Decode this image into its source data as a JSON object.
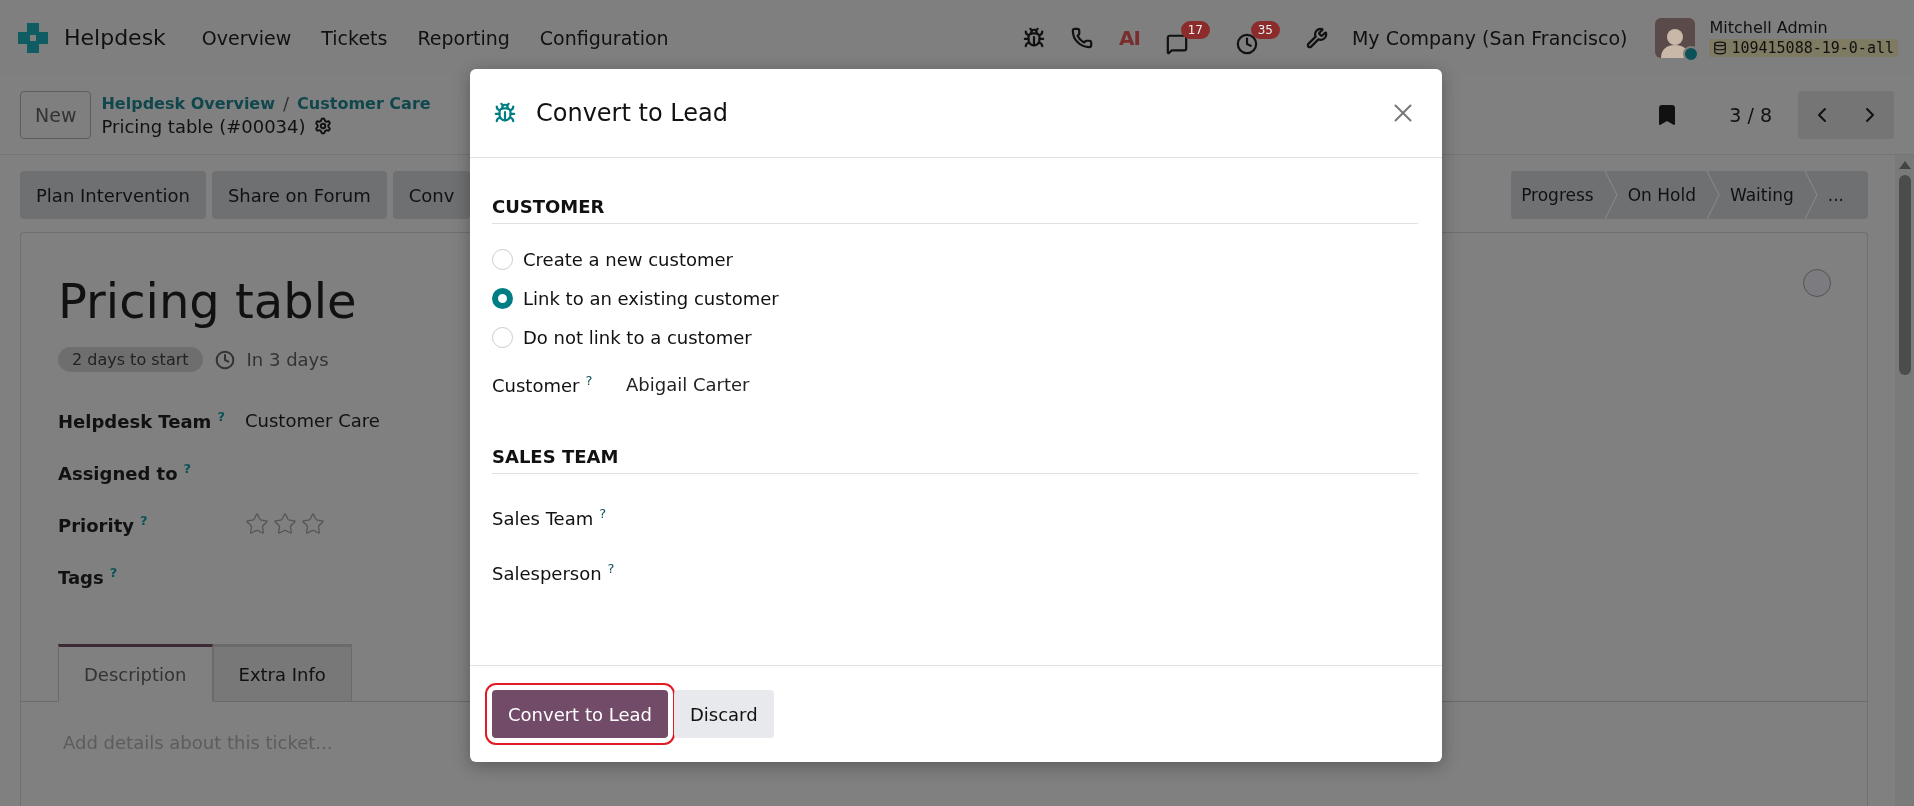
{
  "navbar": {
    "app_name": "Helpdesk",
    "menu": [
      {
        "label": "Overview"
      },
      {
        "label": "Tickets"
      },
      {
        "label": "Reporting"
      },
      {
        "label": "Configuration"
      }
    ],
    "systray": [
      {
        "kind": "bug"
      },
      {
        "kind": "phone"
      },
      {
        "kind": "ai",
        "text": "AI"
      },
      {
        "kind": "messages",
        "count": "17"
      },
      {
        "kind": "activity",
        "count": "35"
      },
      {
        "kind": "tools"
      }
    ],
    "company": "My Company (San Francisco)",
    "user": {
      "name": "Mitchell Admin",
      "database": "109415088-19-0-all"
    }
  },
  "control_panel": {
    "new_button": "New",
    "breadcrumbs": [
      "Helpdesk Overview",
      "Customer Care"
    ],
    "breadcrumb_separator": "/",
    "current": "Pricing table (#00034)",
    "pager": "3 / 8"
  },
  "action_buttons": [
    "Plan Intervention",
    "Share on Forum",
    "Conv"
  ],
  "stages": [
    "Progress",
    "On Hold",
    "Waiting",
    "..."
  ],
  "ticket": {
    "title": "Pricing table",
    "badge": "2 days to start",
    "deadline": "In 3 days",
    "fields": [
      {
        "kind": "text",
        "label": "Helpdesk Team",
        "help": "?",
        "value": "Customer Care"
      },
      {
        "kind": "text",
        "label": "Assigned to",
        "help": "?"
      },
      {
        "kind": "stars",
        "label": "Priority",
        "help": "?",
        "stars": 0
      },
      {
        "kind": "text",
        "label": "Tags",
        "help": "?"
      }
    ],
    "tabs": [
      {
        "label": "Description",
        "selected": true
      },
      {
        "label": "Extra Info",
        "selected": false
      }
    ],
    "description_placeholder": "Add details about this ticket..."
  },
  "dialog": {
    "title": "Convert to Lead",
    "sections": [
      {
        "heading": "CUSTOMER",
        "options": [
          {
            "label": "Create a new customer",
            "selected": false
          },
          {
            "label": "Link to an existing customer",
            "selected": true
          },
          {
            "label": "Do not link to a customer",
            "selected": false
          }
        ],
        "fields": [
          {
            "label": "Customer",
            "help": "?",
            "value": "Abigail Carter"
          }
        ]
      },
      {
        "heading": "SALES TEAM",
        "fields": [
          {
            "label": "Sales Team",
            "help": "?"
          },
          {
            "label": "Salesperson",
            "help": "?"
          }
        ]
      }
    ],
    "buttons": [
      {
        "label": "Convert to Lead",
        "kind": "primary",
        "highlighted": true
      },
      {
        "label": "Discard",
        "kind": "secondary",
        "highlighted": false
      }
    ]
  }
}
